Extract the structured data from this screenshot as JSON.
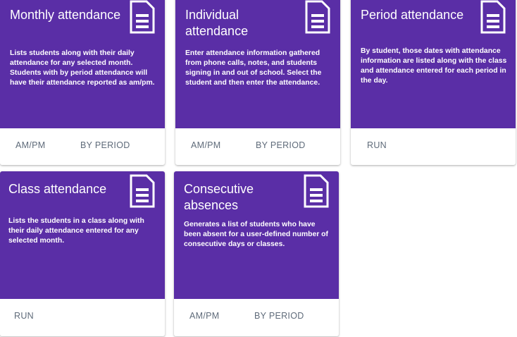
{
  "cards": [
    {
      "title": "Monthly attendance",
      "description": "Lists students along with their daily attendance for any selected month. Students with by period attendance will have their attendance reported as am/pm.",
      "actions": [
        "AM/PM",
        "BY PERIOD"
      ],
      "icon": "document-icon"
    },
    {
      "title": "Individual attendance",
      "description": "Enter attendance information gathered from phone calls, notes, and students signing in and out of school. Select the student and then enter the attendance.",
      "actions": [
        "AM/PM",
        "BY PERIOD"
      ],
      "icon": "document-icon"
    },
    {
      "title": "Period attendance",
      "description": "By student, those dates with attendance information are listed along with the class and attendance entered for each period in the day.",
      "actions": [
        "RUN"
      ],
      "icon": "document-icon"
    },
    {
      "title": "Class attendance",
      "description": "Lists the students in a class along with their daily attendance entered for any selected month.",
      "actions": [
        "RUN"
      ],
      "icon": "document-icon"
    },
    {
      "title": "Consecutive absences",
      "description": "Generates a list of students who have been absent for a user-defined number of consecutive days or classes.",
      "actions": [
        "AM/PM",
        "BY PERIOD"
      ],
      "icon": "document-icon"
    }
  ],
  "colors": {
    "card_header": "#5a2ea6",
    "action_text": "#5f6b7a"
  }
}
